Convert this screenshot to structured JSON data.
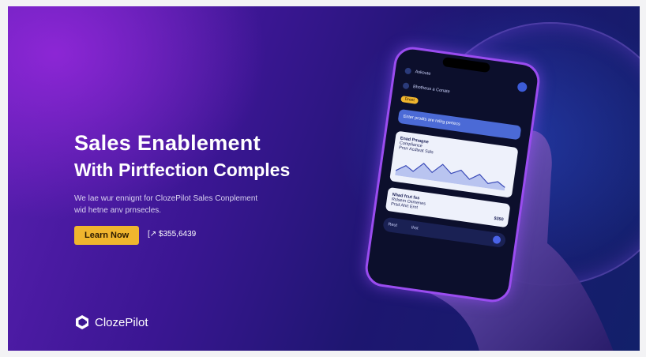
{
  "hero": {
    "title_line1": "Sales Enablement",
    "title_line2": "With Pirtfection Comples",
    "desc_line1": "We lae wur ennignt for ClozePilot Sales Conplement",
    "desc_line2": "wid hetne anv prnsecles.",
    "cta_label": "Learn Now",
    "stat_text": "[↗ $355,6439"
  },
  "brand": {
    "name": "ClozePilot",
    "accent": "#f0b52e"
  },
  "phone": {
    "header": "Askoute",
    "contact": "Bhotheus a Conate",
    "chip": "Dreet",
    "message": "Enter prodts are relirg pertecs",
    "card1": {
      "title": "Enad Pmagne",
      "subtitle": "Compliance",
      "meta": "Prsrr Acdteat Sals"
    },
    "card2": {
      "title": "Nhad fcut fss",
      "line2": "Rslsem Osmenes",
      "line3": "Prsd Ahrt Ernt",
      "value": "$350"
    },
    "composer": {
      "left": "Reut",
      "right": "Ihst"
    }
  }
}
